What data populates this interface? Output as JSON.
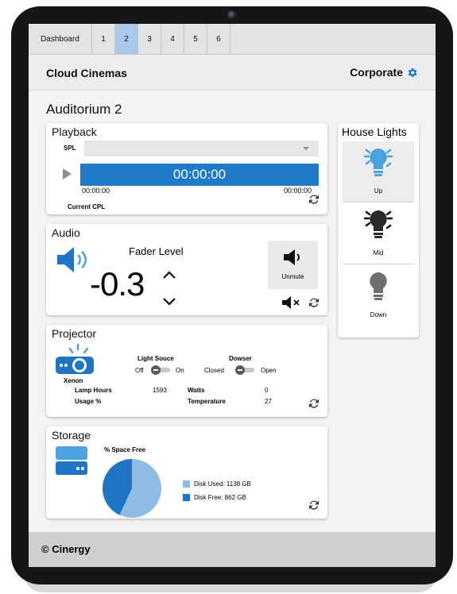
{
  "tabs": [
    "Dashboard",
    "1",
    "2",
    "3",
    "4",
    "5",
    "6"
  ],
  "active_tab": "2",
  "header": {
    "app_title": "Cloud Cinemas",
    "org_label": "Corporate",
    "org_icon": "gear-icon"
  },
  "page_title": "Auditorium 2",
  "playback": {
    "title": "Playback",
    "spl_label": "SPL",
    "spl_value": "",
    "timecode": "00:00:00",
    "time_start": "00:00:00",
    "time_end": "00:00:00",
    "cpl_label": "Current CPL"
  },
  "audio": {
    "title": "Audio",
    "fader_label": "Fader Level",
    "fader_value": "-0.3",
    "unmute_label": "Unmute"
  },
  "projector": {
    "title": "Projector",
    "lamp_type": "Xenon",
    "light_source_label": "Light Souce",
    "light_off": "Off",
    "light_on": "On",
    "dowser_label": "Dowser",
    "dowser_closed": "Closed",
    "dowser_open": "Open",
    "lamp_hours_label": "Lamp Hours",
    "lamp_hours_value": "1593",
    "usage_label": "Usage %",
    "watts_label": "Watts",
    "watts_value": "0",
    "temperature_label": "Temperature",
    "temperature_value": "27"
  },
  "storage": {
    "title": "Storage",
    "chart_label": "% Space Free",
    "legend_used": "Disk Used: 1138 GB",
    "legend_free": "Disk Free: 862 GB",
    "used_gb": 1138,
    "free_gb": 862,
    "used_color": "#8fbce6",
    "free_color": "#1f75c4"
  },
  "house_lights": {
    "title": "House Lights",
    "buttons": [
      {
        "label": "Up",
        "color": "#4aa3df",
        "selected": true
      },
      {
        "label": "Mid",
        "color": "#2a2a2a",
        "selected": false
      },
      {
        "label": "Down",
        "color": "#6e6e6e",
        "selected": false
      }
    ]
  },
  "footer": {
    "copyright": "© Cinergy"
  },
  "colors": {
    "accent": "#1f7ac9",
    "active_tab": "#a9c9ee"
  }
}
